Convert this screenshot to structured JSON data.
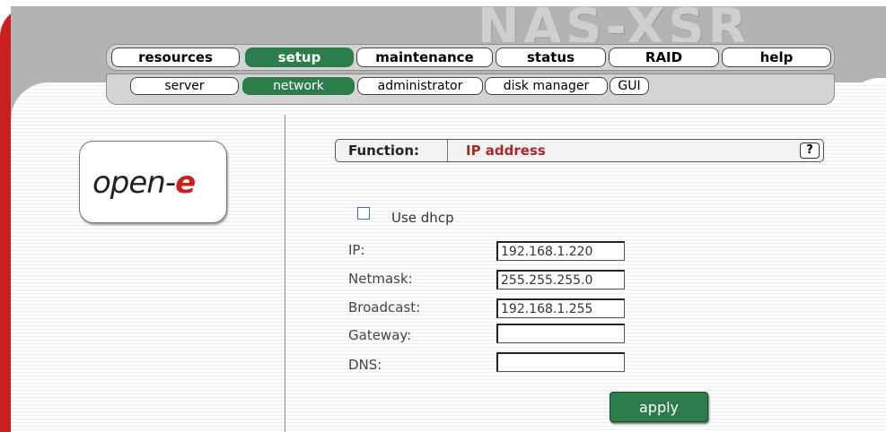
{
  "brand": {
    "product": "NAS-XSR",
    "logo_text_main": "open-",
    "logo_text_accent": "e"
  },
  "colors": {
    "accent_green": "#2d7c4b",
    "frame_red": "#c82020",
    "header_gray": "#b3b3b3"
  },
  "nav": {
    "main_tabs": [
      {
        "label": "resources",
        "active": false
      },
      {
        "label": "setup",
        "active": true
      },
      {
        "label": "maintenance",
        "active": false
      },
      {
        "label": "status",
        "active": false
      },
      {
        "label": "RAID",
        "active": false
      },
      {
        "label": "help",
        "active": false
      }
    ],
    "sub_tabs": [
      {
        "label": "server",
        "active": false
      },
      {
        "label": "network",
        "active": true
      },
      {
        "label": "administrator",
        "active": false
      },
      {
        "label": "disk manager",
        "active": false
      },
      {
        "label": "GUI",
        "active": false
      }
    ]
  },
  "function_bar": {
    "label": "Function:",
    "value": "IP address",
    "help": "?"
  },
  "form": {
    "dhcp": {
      "label": "Use dhcp",
      "checked": false
    },
    "fields": [
      {
        "label": "IP:",
        "value": "192.168.1.220"
      },
      {
        "label": "Netmask:",
        "value": "255.255.255.0"
      },
      {
        "label": "Broadcast:",
        "value": "192.168.1.255"
      },
      {
        "label": "Gateway:",
        "value": ""
      },
      {
        "label": "DNS:",
        "value": ""
      }
    ],
    "apply_label": "apply"
  }
}
